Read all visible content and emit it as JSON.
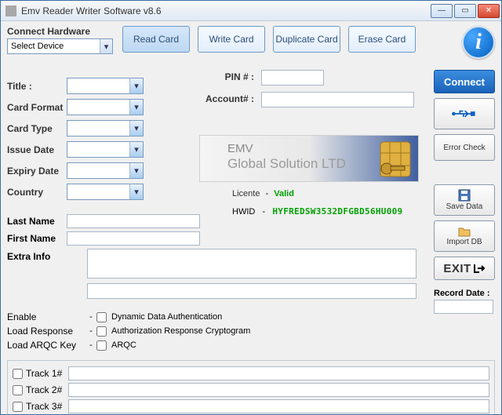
{
  "window": {
    "title": "Emv Reader Writer Software v8.6"
  },
  "connect_hw": {
    "label": "Connect Hardware",
    "placeholder": "Select Device"
  },
  "top_buttons": {
    "read": "Read Card",
    "write": "Write Card",
    "duplicate": "Duplicate Card",
    "erase": "Erase Card"
  },
  "side": {
    "connect": "Connect",
    "error_check": "Error Check",
    "save_data": "Save Data",
    "import_db": "Import DB",
    "exit": "EXIT"
  },
  "form": {
    "title": "Title :",
    "card_format": "Card Format",
    "card_type": "Card Type",
    "issue_date": "Issue Date",
    "expiry_date": "Expiry Date",
    "country": "Country",
    "pin": "PIN # :",
    "account": "Account# :",
    "last_name": "Last Name",
    "first_name": "First Name",
    "extra_info": "Extra Info"
  },
  "banner": {
    "line1": "EMV",
    "line2": "Global Solution LTD"
  },
  "status": {
    "licente_label": "Licente",
    "licente_value": "Valid",
    "hwid_label": "HWID",
    "hwid_value": "HYFREDSW3532DFGBD56HU009"
  },
  "record_date": "Record Date :",
  "checks": {
    "enable": "Enable",
    "enable_opt": "Dynamic Data Authentication",
    "load_response": "Load Response",
    "load_response_opt": "Authorization Response Cryptogram",
    "load_arqc": "Load ARQC Key",
    "load_arqc_opt": "ARQC"
  },
  "tracks": {
    "t1": "Track 1#",
    "t2": "Track 2#",
    "t3": "Track 3#"
  }
}
